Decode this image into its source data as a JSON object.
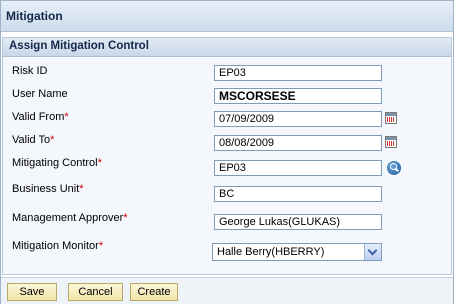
{
  "page": {
    "title": "Mitigation"
  },
  "panel": {
    "title": "Assign Mitigation Control"
  },
  "fields": {
    "risk_id": {
      "label": "Risk ID",
      "value": "EP03"
    },
    "user_name": {
      "label": "User Name",
      "value": "MSCORSESE"
    },
    "valid_from": {
      "label": "Valid From",
      "value": "07/09/2009",
      "required": "*"
    },
    "valid_to": {
      "label": "Valid To",
      "value": "08/08/2009",
      "required": "*"
    },
    "mitigating_control": {
      "label": "Mitigating Control",
      "value": "EP03",
      "required": "*"
    },
    "business_unit": {
      "label": "Business Unit",
      "value": "BC",
      "required": "*"
    },
    "management_approver": {
      "label": "Management Approver",
      "value": "George Lukas(GLUKAS)",
      "required": "*"
    },
    "mitigation_monitor": {
      "label": "Mitigation Monitor",
      "value": "Halle Berry(HBERRY)",
      "required": "*"
    }
  },
  "buttons": {
    "save": "Save",
    "cancel": "Cancel",
    "create": "Create"
  },
  "icons": {
    "calendar": "calendar-icon",
    "lookup": "search-icon",
    "dropdown": "chevron-down-icon"
  },
  "colors": {
    "required": "#cc0000",
    "header_bg": "#cddceb",
    "button_bg": "#f2e4a8"
  }
}
